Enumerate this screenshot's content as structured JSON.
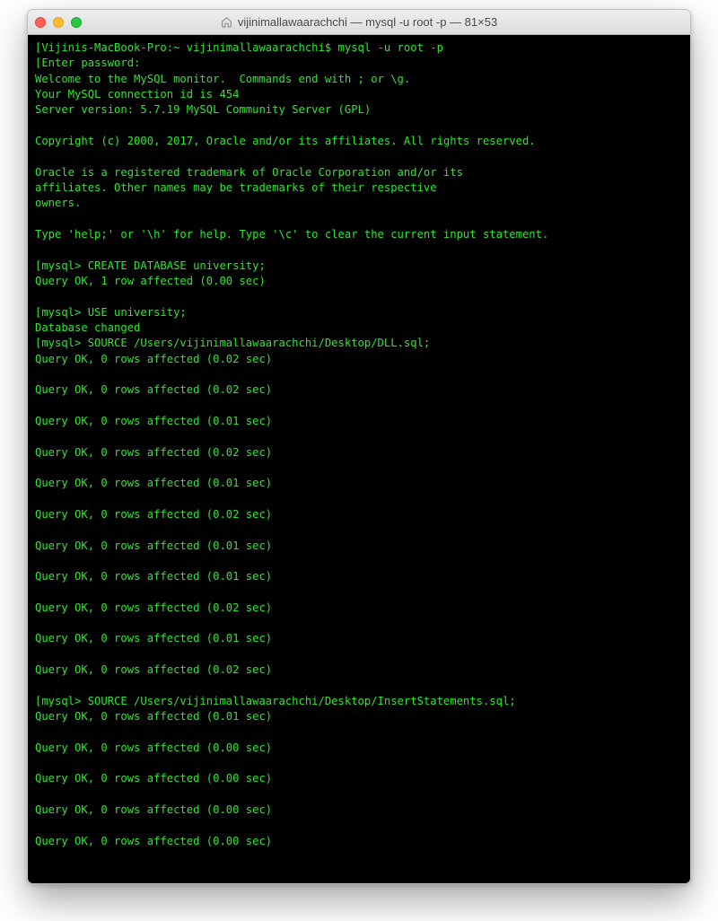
{
  "window": {
    "title": "vijinimallawaarachchi — mysql -u root -p — 81×53"
  },
  "terminal": {
    "lines": [
      "[Vijinis-MacBook-Pro:~ vijinimallawaarachchi$ mysql -u root -p",
      "[Enter password:",
      "Welcome to the MySQL monitor.  Commands end with ; or \\g.",
      "Your MySQL connection id is 454",
      "Server version: 5.7.19 MySQL Community Server (GPL)",
      "",
      "Copyright (c) 2000, 2017, Oracle and/or its affiliates. All rights reserved.",
      "",
      "Oracle is a registered trademark of Oracle Corporation and/or its",
      "affiliates. Other names may be trademarks of their respective",
      "owners.",
      "",
      "Type 'help;' or '\\h' for help. Type '\\c' to clear the current input statement.",
      "",
      "[mysql> CREATE DATABASE university;",
      "Query OK, 1 row affected (0.00 sec)",
      "",
      "[mysql> USE university;",
      "Database changed",
      "[mysql> SOURCE /Users/vijinimallawaarachchi/Desktop/DLL.sql;",
      "Query OK, 0 rows affected (0.02 sec)",
      "",
      "Query OK, 0 rows affected (0.02 sec)",
      "",
      "Query OK, 0 rows affected (0.01 sec)",
      "",
      "Query OK, 0 rows affected (0.02 sec)",
      "",
      "Query OK, 0 rows affected (0.01 sec)",
      "",
      "Query OK, 0 rows affected (0.02 sec)",
      "",
      "Query OK, 0 rows affected (0.01 sec)",
      "",
      "Query OK, 0 rows affected (0.01 sec)",
      "",
      "Query OK, 0 rows affected (0.02 sec)",
      "",
      "Query OK, 0 rows affected (0.01 sec)",
      "",
      "Query OK, 0 rows affected (0.02 sec)",
      "",
      "[mysql> SOURCE /Users/vijinimallawaarachchi/Desktop/InsertStatements.sql;",
      "Query OK, 0 rows affected (0.01 sec)",
      "",
      "Query OK, 0 rows affected (0.00 sec)",
      "",
      "Query OK, 0 rows affected (0.00 sec)",
      "",
      "Query OK, 0 rows affected (0.00 sec)",
      "",
      "Query OK, 0 rows affected (0.00 sec)",
      ""
    ]
  }
}
